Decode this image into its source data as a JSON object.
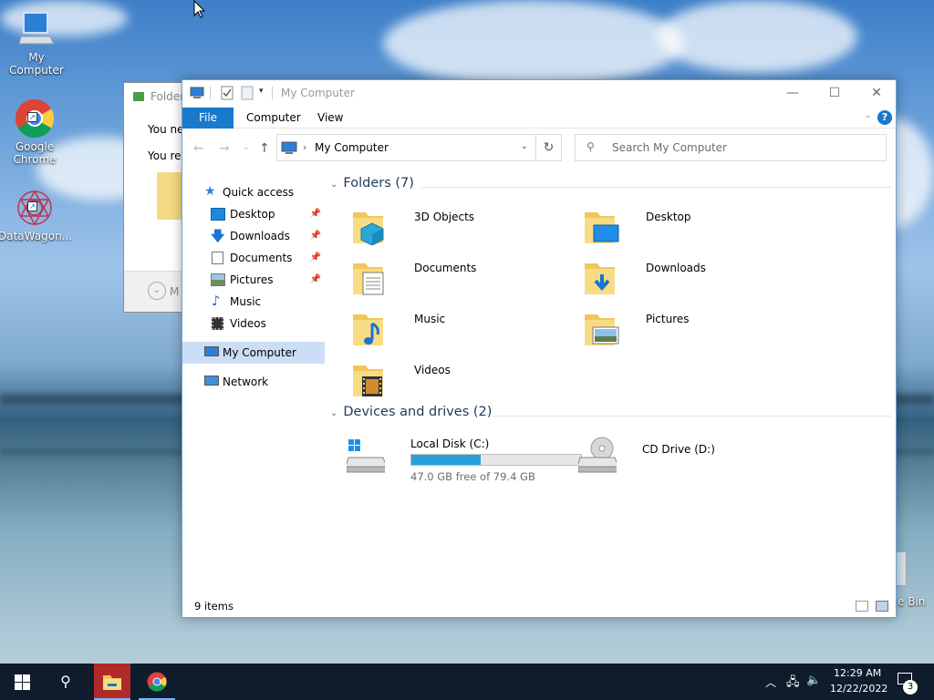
{
  "desktop": {
    "icons": [
      {
        "label": "My Computer"
      },
      {
        "label": "Google Chrome"
      },
      {
        "label": "DataWagon..."
      }
    ],
    "recycle_label": "e Bin"
  },
  "back_window": {
    "title": "Folder",
    "line1": "You ne",
    "line2": "You re",
    "footer_label": "M"
  },
  "window": {
    "title": "My Computer",
    "controls": {
      "minimize": "—",
      "maximize": "☐",
      "close": "✕"
    },
    "ribbon": {
      "file": "File",
      "computer": "Computer",
      "view": "View",
      "help": "?"
    },
    "address": {
      "path": "My Computer"
    },
    "search": {
      "placeholder": "Search My Computer"
    },
    "nav": [
      {
        "label": "Quick access",
        "icon": "star-icon"
      },
      {
        "label": "Desktop",
        "icon": "desktop-icon",
        "pinned": true
      },
      {
        "label": "Downloads",
        "icon": "download-icon",
        "pinned": true
      },
      {
        "label": "Documents",
        "icon": "document-icon",
        "pinned": true
      },
      {
        "label": "Pictures",
        "icon": "picture-icon",
        "pinned": true
      },
      {
        "label": "Music",
        "icon": "music-icon"
      },
      {
        "label": "Videos",
        "icon": "video-icon"
      },
      {
        "label": "My Computer",
        "icon": "computer-icon",
        "selected": true
      },
      {
        "label": "Network",
        "icon": "network-icon"
      }
    ],
    "folders_header": "Folders (7)",
    "folders": [
      {
        "label": "3D Objects"
      },
      {
        "label": "Desktop"
      },
      {
        "label": "Documents"
      },
      {
        "label": "Downloads"
      },
      {
        "label": "Music"
      },
      {
        "label": "Pictures"
      },
      {
        "label": "Videos"
      }
    ],
    "drives_header": "Devices and drives (2)",
    "drives": [
      {
        "label": "Local Disk (C:)",
        "free": "47.0 GB free of 79.4 GB",
        "used_fraction": 0.408
      },
      {
        "label": "CD Drive (D:)"
      }
    ],
    "status": "9 items"
  },
  "taskbar": {
    "time": "12:29 AM",
    "date": "12/22/2022",
    "notifications": "3"
  },
  "colors": {
    "accent": "#1979ca",
    "selection": "#ccdef5",
    "drive_bar": "#26a0da",
    "taskbar": "#0f1c2b"
  }
}
